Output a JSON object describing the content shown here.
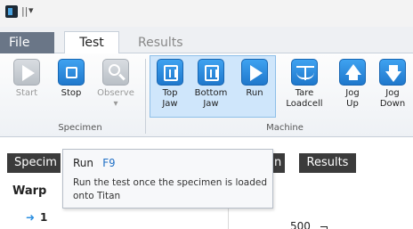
{
  "tabs": {
    "file": "File",
    "test": "Test",
    "results": "Results"
  },
  "ribbon": {
    "specimen_group": {
      "label": "Specimen",
      "start": "Start",
      "stop": "Stop",
      "observe": "Observe"
    },
    "machine_group": {
      "label": "Machine",
      "top_jaw": [
        "Top",
        "Jaw"
      ],
      "bottom_jaw": [
        "Bottom",
        "Jaw"
      ],
      "run": "Run",
      "tare_loadcell": [
        "Tare",
        "Loadcell"
      ],
      "jog_up": [
        "Jog",
        "Up"
      ],
      "jog_down": [
        "Jog",
        "Down"
      ]
    }
  },
  "tooltip": {
    "title": "Run",
    "shortcut": "F9",
    "description": "Run the test once the specimen is loaded onto Titan"
  },
  "lower": {
    "tab_specimen": "Specim",
    "tab_partial": "n",
    "tab_results": "Results",
    "warp_label": "Warp",
    "row_number": "1",
    "y_tick": "500"
  },
  "colors": {
    "accent_blue": "#1f78cc",
    "highlight": "#cfe6fb",
    "file_tab": "#6a7687",
    "dark_tab": "#3b3b3b"
  }
}
